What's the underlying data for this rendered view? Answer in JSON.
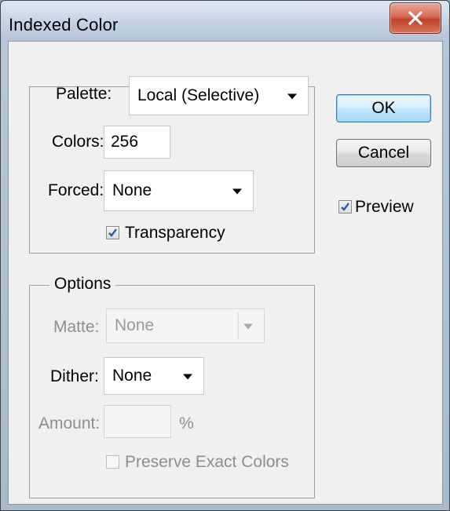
{
  "window": {
    "title": "Indexed Color",
    "close_symbol": "x"
  },
  "palette_group": {
    "palette_label": "Palette:",
    "palette_value": "Local (Selective)",
    "colors_label": "Colors:",
    "colors_value": "256",
    "forced_label": "Forced:",
    "forced_value": "None",
    "transparency_label": "Transparency",
    "transparency_checked": true
  },
  "options_group": {
    "legend": "Options",
    "matte_label": "Matte:",
    "matte_value": "None",
    "dither_label": "Dither:",
    "dither_value": "None",
    "amount_label": "Amount:",
    "amount_value": "",
    "amount_unit": "%",
    "preserve_label": "Preserve Exact Colors",
    "preserve_checked": false
  },
  "buttons": {
    "ok": "OK",
    "cancel": "Cancel"
  },
  "preview": {
    "label": "Preview",
    "checked": true
  },
  "colors": {
    "close_red": "#c0422a",
    "default_button_border": "#3c7fb1",
    "disabled_text": "#8e8e8e"
  }
}
